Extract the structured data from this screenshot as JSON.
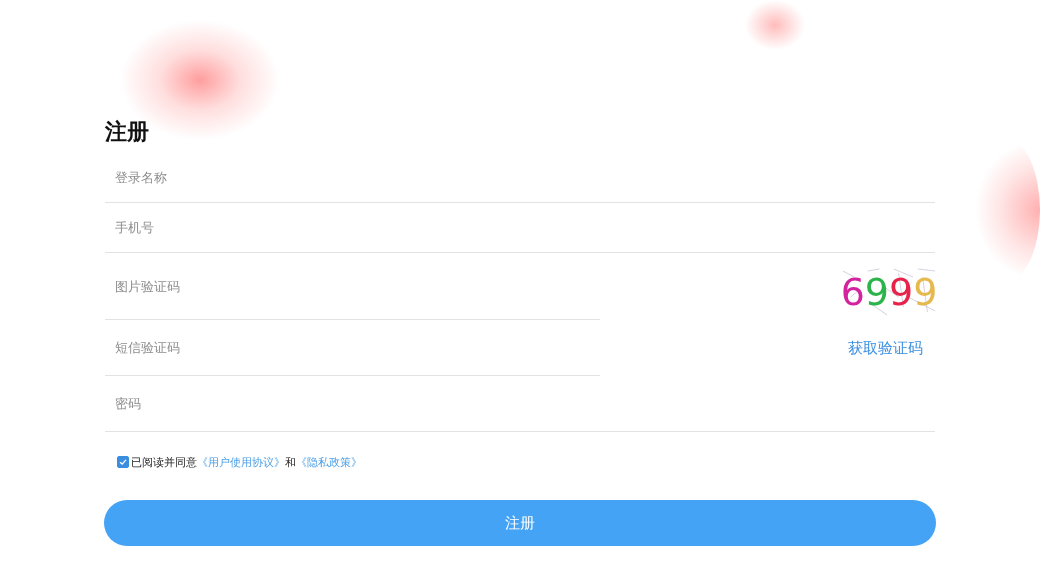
{
  "title": "注册",
  "fields": [
    {
      "kind": "text",
      "placeholder": "登录名称"
    },
    {
      "kind": "text",
      "placeholder": "手机号"
    },
    {
      "kind": "captcha",
      "placeholder": "图片验证码",
      "captcha": [
        {
          "text": "6",
          "color": "#d4239e"
        },
        {
          "text": "9",
          "color": "#2cb34a"
        },
        {
          "text": "9",
          "color": "#e8234a"
        },
        {
          "text": "9",
          "color": "#e6b94e"
        }
      ]
    },
    {
      "kind": "sms",
      "placeholder": "短信验证码",
      "action": "获取验证码"
    },
    {
      "kind": "password",
      "placeholder": "密码"
    }
  ],
  "agreement": {
    "checked": true,
    "text": "已阅读并同意",
    "link1": "《用户使用协议》",
    "joiner": "和",
    "link2": "《隐私政策》"
  },
  "submit": "注册"
}
